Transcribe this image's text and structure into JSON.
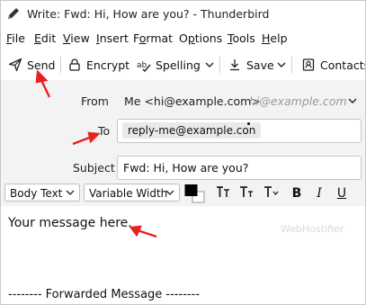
{
  "window": {
    "title": "Write: Fwd: Hi, How are you? - Thunderbird"
  },
  "menubar": {
    "items": [
      "File",
      "Edit",
      "View",
      "Insert",
      "Format",
      "Options",
      "Tools",
      "Help"
    ],
    "mnemonics": [
      "F",
      "E",
      "V",
      "I",
      "o",
      "p",
      "T",
      "H"
    ]
  },
  "toolbar": {
    "send": "Send",
    "encrypt": "Encrypt",
    "spelling": "Spelling",
    "save": "Save",
    "contacts": "Contacts"
  },
  "headers": {
    "from_label": "From",
    "from_value": "Me <hi@example.com>",
    "from_hint": "hi@example.com",
    "to_label": "To",
    "to_recipient": "reply-me@example.con",
    "subject_label": "Subject",
    "subject_value": "Fwd: Hi, How are you?"
  },
  "format": {
    "paragraph": "Body Text",
    "font": "Variable Width"
  },
  "body": {
    "message": "Your message here.",
    "forwarded": "-------- Forwarded Message --------"
  },
  "watermark": "WebHostifier",
  "colors": {
    "annotation_arrow": "#e8201e",
    "header_bg": "#f3f3f3"
  }
}
